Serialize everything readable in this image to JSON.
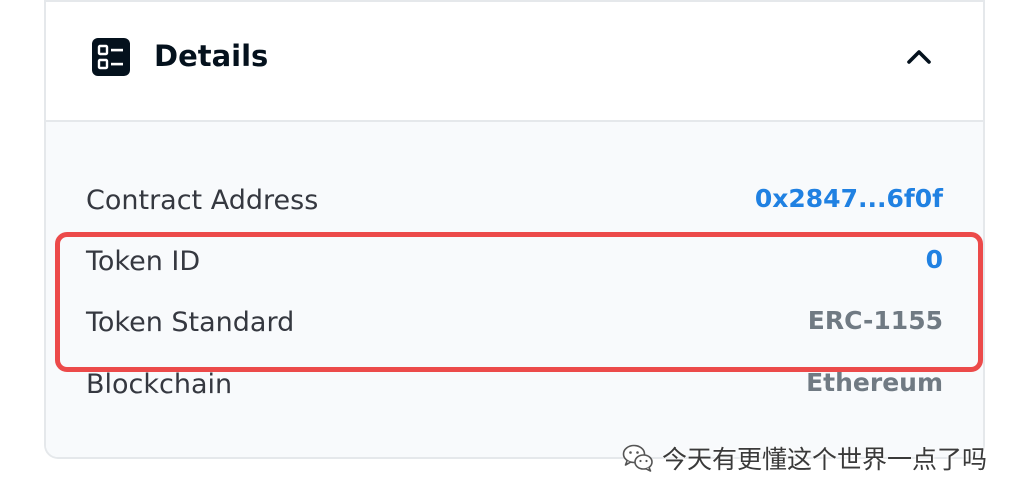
{
  "section": {
    "title": "Details",
    "icon": "details-list-icon",
    "toggle_icon": "chevron-up-icon"
  },
  "details": [
    {
      "label": "Contract Address",
      "value": "0x2847...6f0f",
      "style": "link"
    },
    {
      "label": "Token ID",
      "value": "0",
      "style": "link"
    },
    {
      "label": "Token Standard",
      "value": "ERC-1155",
      "style": "muted"
    },
    {
      "label": "Blockchain",
      "value": "Ethereum",
      "style": "muted"
    }
  ],
  "annotation": {
    "color": "#ec4a4a"
  },
  "watermark": {
    "icon": "wechat-icon",
    "text": "今天有更懂这个世界一点了吗"
  },
  "colors": {
    "link": "#2081e2",
    "muted": "#707a83",
    "text": "#353840",
    "title": "#04111d"
  }
}
